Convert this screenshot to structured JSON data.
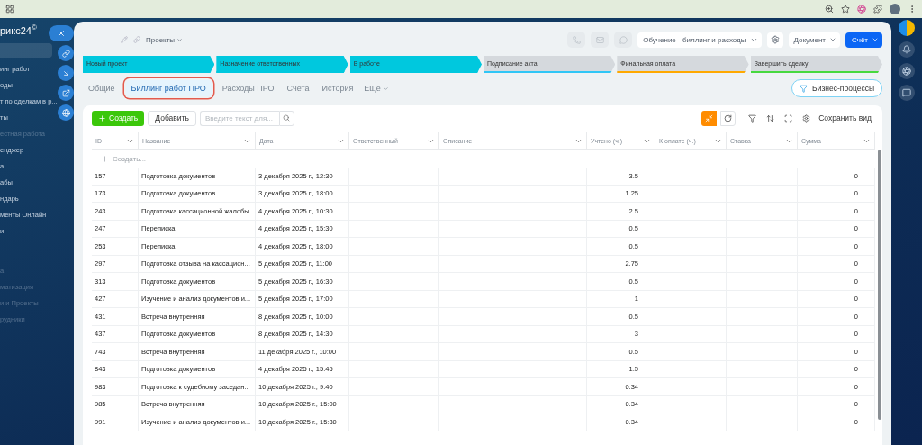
{
  "sidebar": {
    "logo": "рикс24",
    "logo_mark": "©",
    "groups": [
      [
        {
          "label": "инг работ",
          "dimmed": false
        },
        {
          "label": "оды",
          "dimmed": false
        },
        {
          "label": "т по сделкам в р...",
          "dimmed": false
        },
        {
          "label": "ты",
          "dimmed": false
        },
        {
          "label": "естная работа",
          "dimmed": true
        },
        {
          "label": "енджер",
          "dimmed": false
        },
        {
          "label": "а",
          "dimmed": false
        },
        {
          "label": "абы",
          "dimmed": false
        },
        {
          "label": "ндарь",
          "dimmed": false
        },
        {
          "label": "менты Онлайн",
          "dimmed": false
        },
        {
          "label": "и",
          "dimmed": false
        }
      ],
      [
        {
          "label": "а",
          "dimmed": true
        },
        {
          "label": "матизация",
          "dimmed": true
        },
        {
          "label": "и и Проекты",
          "dimmed": true
        },
        {
          "label": "рудники",
          "dimmed": true
        }
      ]
    ]
  },
  "header": {
    "category": "Проекты",
    "pipeline": "Обучение - биллинг и расходы",
    "document": "Документ",
    "primary": "Счёт"
  },
  "stages": [
    {
      "label": "Новый проект",
      "done": true,
      "color": "#00c8de"
    },
    {
      "label": "Назначение ответственных",
      "done": true,
      "color": "#00c8de"
    },
    {
      "label": "В работе",
      "done": true,
      "color": "#00c8de"
    },
    {
      "label": "Подписание акта",
      "done": false,
      "color": "#2fc6f6"
    },
    {
      "label": "Финальная оплата",
      "done": false,
      "color": "#ffa900"
    },
    {
      "label": "Завершить сделку",
      "done": false,
      "color": "#47d93f"
    }
  ],
  "tabs": [
    {
      "label": "Общие",
      "selected": false
    },
    {
      "label": "Биллинг работ ПРО",
      "selected": true
    },
    {
      "label": "Расходы ПРО",
      "selected": false
    },
    {
      "label": "Счета",
      "selected": false
    },
    {
      "label": "История",
      "selected": false
    }
  ],
  "more_tab": "Еще",
  "business_processes": "Бизнес-процессы",
  "toolbar": {
    "create": "Создать",
    "add": "Добавить",
    "search_placeholder": "Введите текст для...",
    "save_view": "Сохранить вид"
  },
  "table": {
    "columns": [
      "ID",
      "Название",
      "Дата",
      "Ответственный",
      "Описание",
      "Учтено (ч.)",
      "К оплате (ч.)",
      "Ставка",
      "Сумма"
    ],
    "create_row": "Создать...",
    "rows": [
      {
        "id": "157",
        "name": "Подготовка документов",
        "date": "3 декабря 2025 г., 12:30",
        "accounted": "3.5",
        "amount": "0"
      },
      {
        "id": "173",
        "name": "Подготовка документов",
        "date": "3 декабря 2025 г., 18:00",
        "accounted": "1.25",
        "amount": "0"
      },
      {
        "id": "243",
        "name": "Подготовка кассационной жалобы",
        "date": "4 декабря 2025 г., 10:30",
        "accounted": "2.5",
        "amount": "0"
      },
      {
        "id": "247",
        "name": "Переписка",
        "date": "4 декабря 2025 г., 15:30",
        "accounted": "0.5",
        "amount": "0"
      },
      {
        "id": "253",
        "name": "Переписка",
        "date": "4 декабря 2025 г., 18:00",
        "accounted": "0.5",
        "amount": "0"
      },
      {
        "id": "297",
        "name": "Подготовка отзыва на кассацион...",
        "date": "5 декабря 2025 г., 11:00",
        "accounted": "2.75",
        "amount": "0"
      },
      {
        "id": "313",
        "name": "Подготовка документов",
        "date": "5 декабря 2025 г., 16:30",
        "accounted": "0.5",
        "amount": "0"
      },
      {
        "id": "427",
        "name": "Изучение и анализ документов и...",
        "date": "5 декабря 2025 г., 17:00",
        "accounted": "1",
        "amount": "0"
      },
      {
        "id": "431",
        "name": "Встреча внутренняя",
        "date": "8 декабря 2025 г., 10:00",
        "accounted": "0.5",
        "amount": "0"
      },
      {
        "id": "437",
        "name": "Подготовка документов",
        "date": "8 декабря 2025 г., 14:30",
        "accounted": "3",
        "amount": "0"
      },
      {
        "id": "743",
        "name": "Встреча внутренняя",
        "date": "11 декабря 2025 г., 10:00",
        "accounted": "0.5",
        "amount": "0"
      },
      {
        "id": "843",
        "name": "Подготовка документов",
        "date": "4 декабря 2025 г., 15:45",
        "accounted": "1.5",
        "amount": "0"
      },
      {
        "id": "983",
        "name": "Подготовка к судебному заседан...",
        "date": "10 декабря 2025 г., 9:40",
        "accounted": "0.34",
        "amount": "0"
      },
      {
        "id": "985",
        "name": "Встреча внутренняя",
        "date": "10 декабря 2025 г., 15:00",
        "accounted": "0.34",
        "amount": "0"
      },
      {
        "id": "991",
        "name": "Изучение и анализ документов и...",
        "date": "10 декабря 2025 г., 15:30",
        "accounted": "0.34",
        "amount": "0"
      }
    ]
  }
}
